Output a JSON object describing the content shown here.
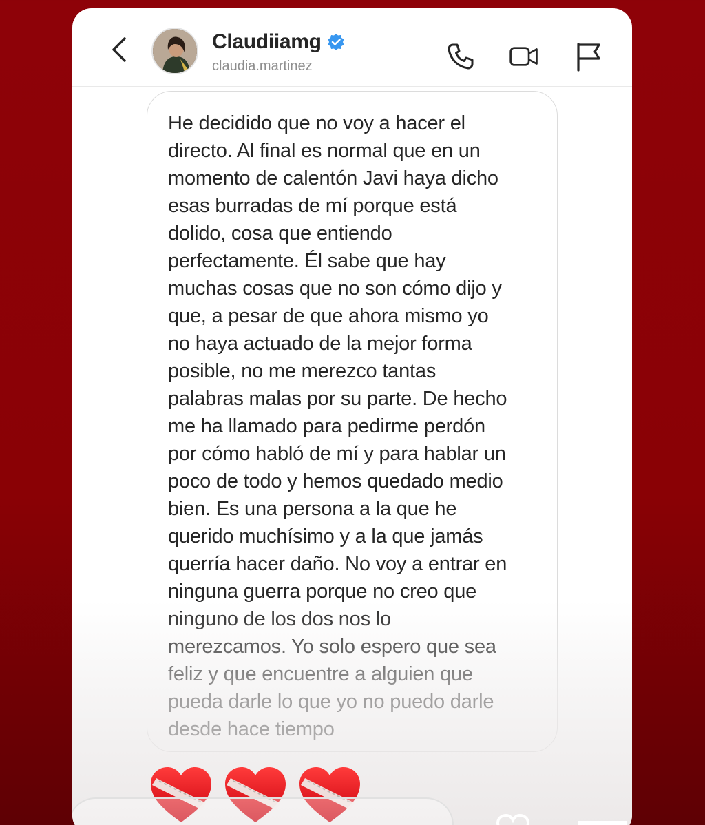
{
  "header": {
    "username": "Claudiiamg",
    "handle": "claudia.martinez",
    "verified": true,
    "back_icon": "chevron-left-icon",
    "call_icon": "phone-icon",
    "video_icon": "video-camera-icon",
    "report_icon": "flag-icon"
  },
  "message": {
    "text": "He decidido que no voy a hacer el\ndirecto. Al final es normal que en un\nmomento de calentón Javi haya dicho\nesas burradas de mí porque está\ndolido, cosa que entiendo\nperfectamente. Él sabe que hay\nmuchas cosas que no son cómo dijo y\nque, a pesar de que ahora mismo yo\nno haya actuado de la mejor forma\nposible, no me merezco tantas\npalabras malas por su parte. De hecho\nme ha llamado para pedirme perdón\npor cómo habló de mí y para hablar un\npoco de todo y hemos quedado medio\nbien. Es una persona a la que he\nquerido muchísimo y a la que jamás\nquerría hacer daño. No voy a entrar en\nninguna guerra porque no creo que\nninguno de los dos nos lo\nmerezcamos. Yo solo espero que sea\nfeliz y que encuentre a alguien que\npueda darle lo que yo no puedo darle\ndesde hace tiempo"
  },
  "reactions": [
    "bandaged-heart-icon",
    "bandaged-heart-icon",
    "bandaged-heart-icon"
  ],
  "colors": {
    "background": "#8e0208",
    "verified_blue": "#3897f0",
    "heart_red": "#e0141e",
    "text": "#262626",
    "muted": "#8e8e8e"
  }
}
